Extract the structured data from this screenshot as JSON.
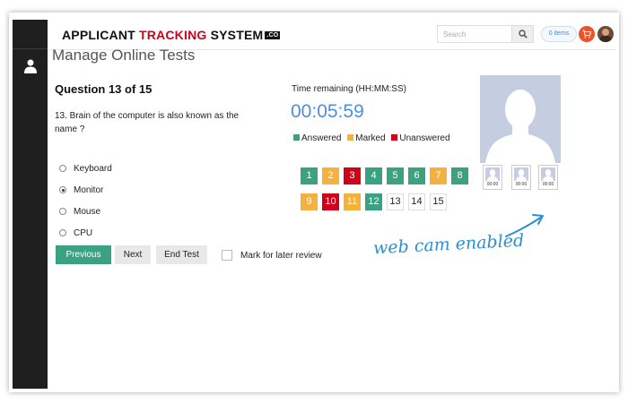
{
  "header": {
    "logo_part1": "APPLICANT ",
    "logo_part2": "TRACKING",
    "logo_part3": " SYSTEM",
    "logo_badge": ".CO",
    "search_placeholder": "Search",
    "items_label": "0 items"
  },
  "page": {
    "title": "Manage Online Tests"
  },
  "question": {
    "header": "Question 13 of 15",
    "text": "13. Brain of the computer is also known as the name ?",
    "options": [
      "Keyboard",
      "Monitor",
      "Mouse",
      "CPU"
    ],
    "selected_index": 1
  },
  "buttons": {
    "previous": "Previous",
    "next": "Next",
    "end_test": "End Test"
  },
  "review": {
    "label": "Mark for later review",
    "checked": false
  },
  "timer": {
    "label": "Time remaining (HH:MM:SS)",
    "value": "00:05:59"
  },
  "legend": {
    "answered": "Answered",
    "marked": "Marked",
    "unanswered": "Unanswered"
  },
  "colors": {
    "answered": "#3aa181",
    "marked": "#f5b13d",
    "unanswered": "#d0021b",
    "timer": "#4a90e2",
    "accent": "#2a8fd4"
  },
  "question_nav": [
    {
      "num": "1",
      "status": "answered"
    },
    {
      "num": "2",
      "status": "marked"
    },
    {
      "num": "3",
      "status": "unanswered"
    },
    {
      "num": "4",
      "status": "answered"
    },
    {
      "num": "5",
      "status": "answered"
    },
    {
      "num": "6",
      "status": "answered"
    },
    {
      "num": "7",
      "status": "marked"
    },
    {
      "num": "8",
      "status": "answered"
    },
    {
      "num": "9",
      "status": "marked"
    },
    {
      "num": "10",
      "status": "unanswered"
    },
    {
      "num": "11",
      "status": "marked"
    },
    {
      "num": "12",
      "status": "answered"
    },
    {
      "num": "13",
      "status": "empty"
    },
    {
      "num": "14",
      "status": "empty"
    },
    {
      "num": "15",
      "status": "empty"
    }
  ],
  "webcam": {
    "thumbnails": [
      "00:00",
      "00:00",
      "00:00"
    ]
  },
  "annotation": "web cam enabled",
  "icons": {
    "sidebar": "user-icon",
    "search": "search-icon",
    "cart": "cart-icon"
  }
}
